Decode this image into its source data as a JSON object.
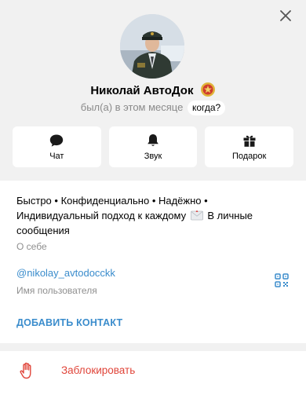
{
  "profile": {
    "name": "Николай АвтоДок",
    "status": "был(а) в этом месяце",
    "when_label": "когда?"
  },
  "actions": [
    {
      "label": "Чат",
      "icon": "chat-icon"
    },
    {
      "label": "Звук",
      "icon": "bell-icon"
    },
    {
      "label": "Подарок",
      "icon": "gift-icon"
    }
  ],
  "info": {
    "bio_part1": "Быстро • Конфиденциально • Надёжно • Индивидуальный подход к каждому",
    "bio_part2": "В личные сообщения",
    "bio_label": "О себе",
    "username": "@nikolay_avtodocckk",
    "username_label": "Имя пользователя",
    "add_contact": "ДОБАВИТЬ КОНТАКТ"
  },
  "block": {
    "label": "Заблокировать"
  },
  "colors": {
    "accent": "#3a8ccc",
    "danger": "#e0453a",
    "background": "#f1f1f1"
  }
}
